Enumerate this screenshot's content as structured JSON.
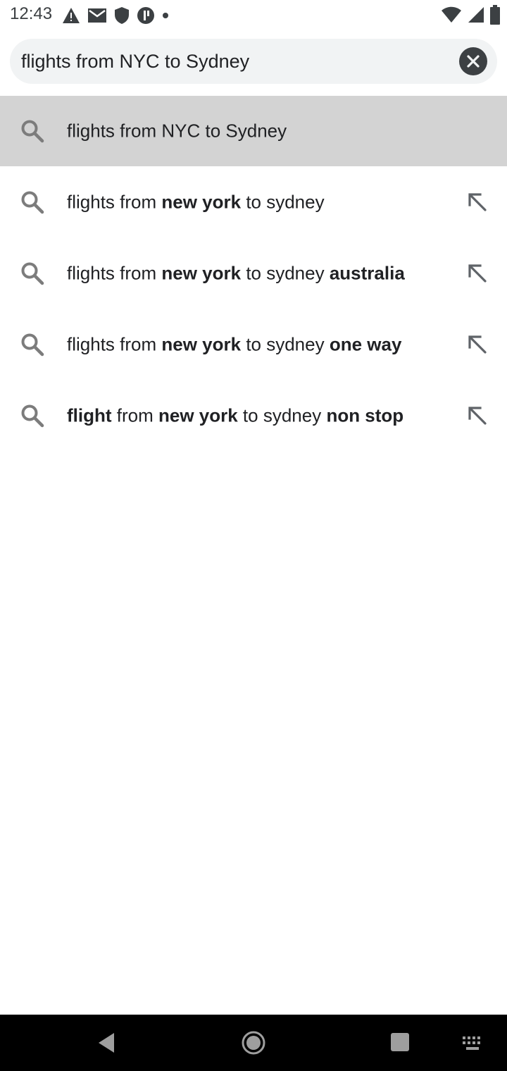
{
  "status_bar": {
    "time": "12:43",
    "left_icons": [
      "warning-icon",
      "gmail-icon",
      "shield-icon",
      "notification-icon",
      "dot-icon"
    ],
    "right_icons": [
      "wifi-icon",
      "signal-icon",
      "battery-icon"
    ]
  },
  "search": {
    "query": "flights from NYC to Sydney",
    "clear_icon": "close-icon"
  },
  "suggestions": [
    {
      "segments": [
        {
          "text": "flights from NYC to Sydney",
          "bold": false
        }
      ],
      "highlighted": true,
      "has_fill_icon": false
    },
    {
      "segments": [
        {
          "text": "flights from ",
          "bold": false
        },
        {
          "text": "new york",
          "bold": true
        },
        {
          "text": " to sydney",
          "bold": false
        }
      ],
      "highlighted": false,
      "has_fill_icon": true
    },
    {
      "segments": [
        {
          "text": "flights from ",
          "bold": false
        },
        {
          "text": "new york",
          "bold": true
        },
        {
          "text": " to sydney ",
          "bold": false
        },
        {
          "text": "australia",
          "bold": true
        }
      ],
      "highlighted": false,
      "has_fill_icon": true
    },
    {
      "segments": [
        {
          "text": "flights from ",
          "bold": false
        },
        {
          "text": "new york",
          "bold": true
        },
        {
          "text": " to sydney ",
          "bold": false
        },
        {
          "text": "one way",
          "bold": true
        }
      ],
      "highlighted": false,
      "has_fill_icon": true
    },
    {
      "segments": [
        {
          "text": "flight",
          "bold": true
        },
        {
          "text": " from ",
          "bold": false
        },
        {
          "text": "new york",
          "bold": true
        },
        {
          "text": " to sydney ",
          "bold": false
        },
        {
          "text": "non stop",
          "bold": true
        }
      ],
      "highlighted": false,
      "has_fill_icon": true
    }
  ],
  "nav_bar": {
    "buttons": [
      "back-icon",
      "home-icon",
      "recents-icon",
      "keyboard-icon"
    ]
  },
  "colors": {
    "highlight": "#d3d3d3",
    "search_bg": "#f1f3f4",
    "nav_bg": "#000000"
  }
}
